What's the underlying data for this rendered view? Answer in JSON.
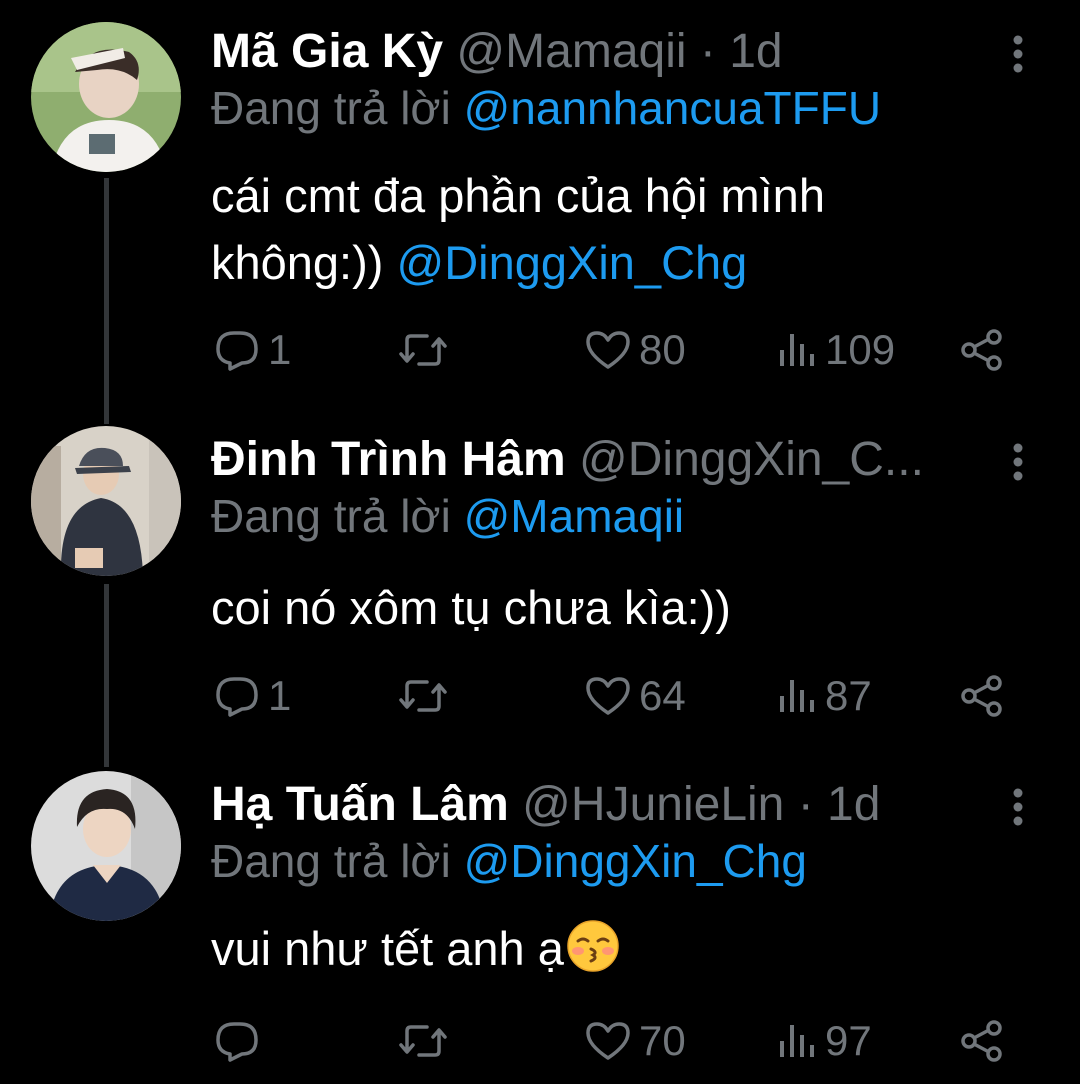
{
  "tweets": [
    {
      "name": "Mã Gia Kỳ",
      "handle": "@Mamaqii",
      "separator": "·",
      "time": "1d",
      "reply_prefix": "Đang trả lời",
      "reply_to": "@nannhancuaTFFU",
      "text_line1": "cái cmt đa phần của hội mình",
      "text_line2_plain": "không:))",
      "text_line2_mention": "@DinggXin_Chg",
      "replies": "1",
      "retweets": "",
      "likes": "80",
      "views": "109"
    },
    {
      "name": "Đinh Trình Hâm",
      "handle": "@DinggXin_C...",
      "separator": "",
      "time": "",
      "reply_prefix": "Đang trả lời",
      "reply_to": "@Mamaqii",
      "text_line1": "coi nó xôm tụ chưa kìa:))",
      "replies": "1",
      "retweets": "",
      "likes": "64",
      "views": "87"
    },
    {
      "name": "Hạ Tuấn Lâm",
      "handle": "@HJunieLin",
      "separator": "·",
      "time": "1d",
      "reply_prefix": "Đang trả lời",
      "reply_to": "@DinggXin_Chg",
      "text_line1": "vui như tết anh ạ",
      "emoji": "kissing-face-closed-eyes",
      "replies": "",
      "retweets": "",
      "likes": "70",
      "views": "97"
    }
  ],
  "colors": {
    "background": "#000000",
    "text": "#ffffff",
    "muted": "#71767b",
    "link": "#1d9bf0",
    "thread_line": "#333639"
  },
  "icons": [
    "reply-icon",
    "retweet-icon",
    "like-icon",
    "views-icon",
    "share-icon",
    "more-icon"
  ]
}
